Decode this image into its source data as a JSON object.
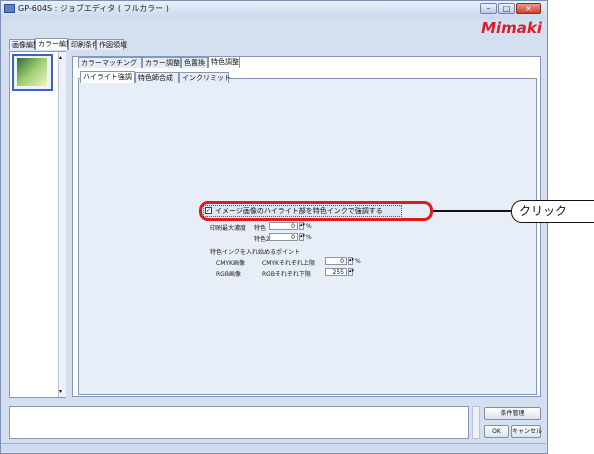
{
  "window": {
    "title": "GP-604S : ジョブエディタ ( フルカラー )",
    "brand": "Mimaki"
  },
  "main_tabs": [
    "画像編集",
    "カラー編集",
    "印刷条件",
    "作図領域"
  ],
  "sub_tabs": [
    "カラーマッチング",
    "カラー調整",
    "色置換",
    "特色調整"
  ],
  "inner_tabs": [
    "ハイライト強調",
    "特色師合成",
    "インクリミット"
  ],
  "highlight_panel": {
    "checkbox_label": "イメージ画像のハイライト部を特色インクで強調する",
    "checked": true,
    "max_density_label": "印刷最大濃度",
    "spot1_label": "特色",
    "spot1_value": "0",
    "spot2_label": "特色2",
    "spot2_value": "0",
    "percent_unit": "%",
    "start_point_label": "特色インクを入れ始めるポイント",
    "cmyk_image_label": "CMYK画像",
    "cmyk_upper_label": "CMYKそれぞれ上限",
    "cmyk_value": "0",
    "rgb_image_label": "RGB画像",
    "rgb_lower_label": "RGBそれぞれ下限",
    "rgb_value": "255"
  },
  "bottom_buttons": {
    "condition_manage": "条件管理",
    "ok": "OK",
    "cancel": "キャンセル"
  },
  "annotation": {
    "callout": "クリック",
    "color": "#e11a1a"
  }
}
